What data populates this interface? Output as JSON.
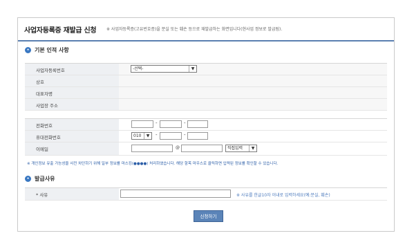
{
  "header": {
    "title": "사업자등록증 재발급 신청",
    "note": "※ 사업자등록증(고유번호증)을 분실 또는 훼손 등으로 재발급하는 화면입니다(현사업 정보로 발급됨)."
  },
  "basic": {
    "heading": "기본 인적 사항",
    "rows": [
      {
        "label": "사업자등록번호",
        "select": "-선택-"
      },
      {
        "label": "상호"
      },
      {
        "label": "대표자명"
      },
      {
        "label": "사업장 주소"
      }
    ]
  },
  "contact": {
    "phone_label": "전화번호",
    "mobile_label": "휴대전화번호",
    "mobile_prefix": "010",
    "email_label": "이메일",
    "at": "@",
    "email_domain": "직접입력"
  },
  "privacy_note": "※ 개인정보 유출 가능성을 사전 차단하기 위해 일부 정보를 마스킹(●●●●) 처리하였습니다. 해당 항목 마우스로 클릭하면 입력된 정보를 확인할 수 있습니다.",
  "issuance": {
    "heading": "발급사유",
    "reason_label": "* 사유",
    "reason_hint": "※ 사유를 한글10자 이내로 입력하세요(예:분실, 훼손)"
  },
  "submit_label": "신청하기",
  "colors": {
    "accent": "#5b84b8",
    "bullet": "#3a78c2"
  }
}
